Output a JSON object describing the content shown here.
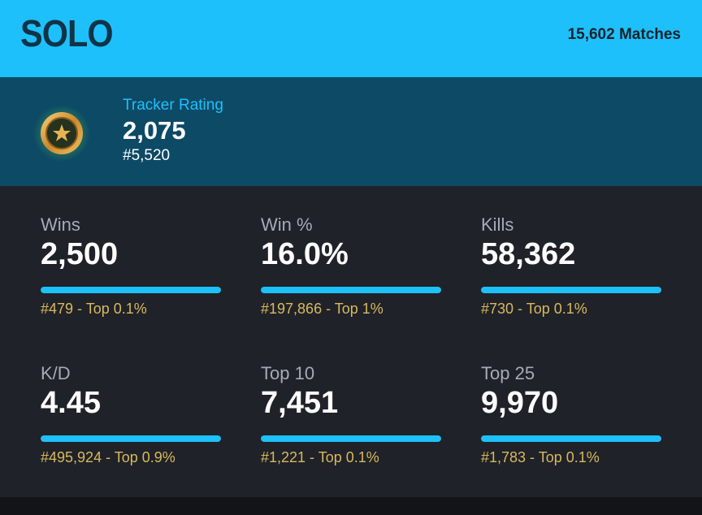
{
  "header": {
    "mode": "SOLO",
    "matches": "15,602 Matches"
  },
  "rating": {
    "label": "Tracker Rating",
    "value": "2,075",
    "rank": "#5,520"
  },
  "stats": [
    {
      "label": "Wins",
      "value": "2,500",
      "rank": "#479 - Top 0.1%",
      "progress": 1.0
    },
    {
      "label": "Win %",
      "value": "16.0%",
      "rank": "#197,866 - Top 1%",
      "progress": 1.0
    },
    {
      "label": "Kills",
      "value": "58,362",
      "rank": "#730 - Top 0.1%",
      "progress": 1.0
    },
    {
      "label": "K/D",
      "value": "4.45",
      "rank": "#495,924 - Top 0.9%",
      "progress": 1.0
    },
    {
      "label": "Top 10",
      "value": "7,451",
      "rank": "#1,221 - Top 0.1%",
      "progress": 1.0
    },
    {
      "label": "Top 25",
      "value": "9,970",
      "rank": "#1,783 - Top 0.1%",
      "progress": 1.0
    }
  ],
  "colors": {
    "accent": "#1ec0fb",
    "header_bg": "#1ec0fb",
    "rating_bg": "#0d4a66",
    "body_bg": "#1f2228",
    "rank_gold": "#d9b85d"
  },
  "icons": {
    "badge": "star-medal-icon"
  }
}
